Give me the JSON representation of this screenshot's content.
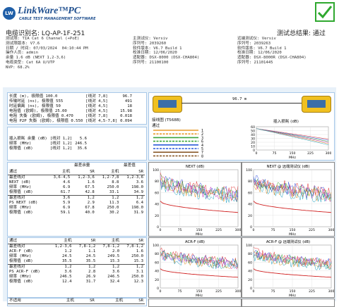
{
  "header": {
    "logo_badge": "LW",
    "brand": "LinkWare™PC",
    "brand_sub": "CABLE TEST MANAGEMENT SOFTWARE"
  },
  "id": {
    "cable_id": "电缆识别名: LQ-AP-1F-251",
    "summary": "测试总结果: 通过"
  },
  "info_left": [
    "测试限: TIA Cat 6 Channel (+PoE)",
    "测试限版本: V7.6",
    "日期 / 时间: 07/03/2024  04:10:44 PM",
    "操作人员: admin",
    "余量 1.6 dB (NEXT 1,2-3,6)",
    "电缆类型: Cat 6A U/UTP",
    "NVP: 68.2%"
  ],
  "info_mid": [
    "主测试仪: Versiv",
    "序列号: 2039260",
    "软件版本: V6.7 Build 1",
    "校准日期: 12/06/2020",
    "适配器: DSX-8000 (DSX-CHA804)",
    "序列号: 21100100"
  ],
  "info_right": [
    "远端测试仪: Versiv",
    "序列号: 2039263",
    "软件版本: V6.7 Build 1",
    "校准日期: 12/06/2020",
    "适配器: DSX-8000R (DSX-CHA804)",
    "序列号: 21101445"
  ],
  "length_block": {
    "rows": [
      {
        "label": "长度 (m), 极限值 100.0",
        "pair": "[线对 7,8]",
        "value": "96.7"
      },
      {
        "label": "传输时延 (ns), 极限值 555",
        "pair": "[线对 4,5]",
        "value": "491"
      },
      {
        "label": "时延偏离 (ns), 极限值 50",
        "pair": "[线对 4,5]",
        "value": "18"
      },
      {
        "label": "电阻值 (欧姆), 极限值 25.00",
        "pair": "[线对 4,5]",
        "value": "15.98"
      },
      {
        "label": "电阻 失衡 (欧姆), 极限值 0.470",
        "pair": "[线对 7,8]",
        "value": "0.018"
      },
      {
        "label": "电阻 P2P 失衡 (欧姆), 极限值 0.550",
        "pair": "[线对 4,5-7,8]",
        "value": "0.094"
      }
    ]
  },
  "insertion_block": {
    "rows": [
      {
        "label": "插入损耗 余量 (dB)",
        "pair": "[线对 1,2]",
        "value": "5.6"
      },
      {
        "label": "频率 (MHz)",
        "pair": "[线对 1,2]",
        "value": "246.5"
      },
      {
        "label": "极限值 (dB)",
        "pair": "[线对 1,2]",
        "value": "35.6"
      }
    ]
  },
  "wiremap": {
    "length_label": "96.7 m",
    "title": "接线图 (T568B)",
    "status": "通过",
    "pins": [
      "1",
      "2",
      "3",
      "6",
      "4",
      "5",
      "7",
      "8"
    ],
    "colors": [
      "#e89a2a",
      "#e89a2a",
      "#3aa43a",
      "#3aa43a",
      "#2a5ad8",
      "#2a5ad8",
      "#8a5a2a",
      "#8a5a2a"
    ]
  },
  "tables": {
    "t1": {
      "head": [
        "通过",
        "主机",
        "SR",
        "主机",
        "SR"
      ],
      "title_left": "最差余量",
      "title_right": "最差值",
      "rows": [
        [
          "最差线对",
          "3,6-4,5",
          "1,2-3,6",
          "1,2-7,8",
          "1,2-3,6"
        ],
        [
          "NEXT (dB)",
          "4.6",
          "1.6",
          "8.8",
          "3.6"
        ],
        [
          "频率 (MHz)",
          "6.9",
          "67.5",
          "250.0",
          "198.0"
        ],
        [
          "极限值 (dB)",
          "61.7",
          "42.8",
          "33.1",
          "34.9"
        ],
        [
          "最差线对",
          "3,6",
          "1,2",
          "1,2",
          "1,2"
        ],
        [
          "PS NEXT (dB)",
          "5.9",
          "2.9",
          "11.3",
          "6.4"
        ],
        [
          "频率 (MHz)",
          "6.9",
          "67.8",
          "250.0",
          "198.0"
        ],
        [
          "极限值 (dB)",
          "59.1",
          "40.0",
          "30.2",
          "31.9"
        ]
      ]
    },
    "t2": {
      "head": [
        "通过",
        "主机",
        "SR",
        "主机",
        "SR"
      ],
      "rows": [
        [
          "最差线对",
          "1,2-3,6",
          "7,8-1,2",
          "7,8-1,2",
          "7,8-1,2"
        ],
        [
          "ACR-F (dB)",
          "1.2",
          "1.1",
          "2.0",
          "1.6"
        ],
        [
          "频率 (MHz)",
          "24.5",
          "24.5",
          "249.5",
          "250.0"
        ],
        [
          "极限值 (dB)",
          "35.5",
          "35.5",
          "15.3",
          "15.3"
        ],
        [
          "最差线对",
          "1,2",
          "1,2",
          "1,2",
          "1,2"
        ],
        [
          "PS ACR-F (dB)",
          "3.6",
          "2.8",
          "3.6",
          "3.1"
        ],
        [
          "频率 (MHz)",
          "246.5",
          "26.9",
          "246.5",
          "250.0"
        ],
        [
          "极限值 (dB)",
          "12.4",
          "31.7",
          "32.4",
          "12.3"
        ]
      ]
    },
    "t3": {
      "head": [
        "不适用",
        "主机",
        "SR",
        "主机",
        "SR"
      ]
    }
  },
  "charts": {
    "insertion": {
      "title": "插入损耗 (dB)",
      "xlabel": "MHz",
      "yticks": [
        "60",
        "50",
        "40",
        "30",
        "20",
        "10",
        "0"
      ],
      "xticks": [
        "0",
        "75",
        "150",
        "225",
        "300"
      ]
    },
    "next": {
      "title": "NEXT (dB)",
      "xlabel": "MHz",
      "yticks": [
        "100",
        "80",
        "60",
        "40",
        "20",
        "0"
      ],
      "xticks": [
        "0",
        "75",
        "150",
        "225",
        "300"
      ]
    },
    "next_sr": {
      "title": "NEXT @ 远端测试仪 (dB)",
      "xlabel": "MHz",
      "yticks": [
        "100",
        "80",
        "60",
        "40",
        "20",
        "0"
      ],
      "xticks": [
        "0",
        "75",
        "150",
        "225",
        "300"
      ]
    },
    "acrf": {
      "title": "ACR-F (dB)",
      "xlabel": "MHz",
      "yticks": [
        "100",
        "80",
        "60",
        "40",
        "20",
        "0"
      ],
      "xticks": [
        "0",
        "75",
        "150",
        "225",
        "300"
      ]
    },
    "acrf_sr": {
      "title": "ACR-F @ 远端测试仪 (dB)",
      "xlabel": "MHz",
      "yticks": [
        "100",
        "80",
        "60",
        "40",
        "20",
        "0"
      ],
      "xticks": [
        "0",
        "75",
        "150",
        "225",
        "300"
      ]
    }
  },
  "colors": {
    "accent": "#1f5fa8",
    "pass": "#2fa82f",
    "panel_bg": "#eef5fb"
  }
}
